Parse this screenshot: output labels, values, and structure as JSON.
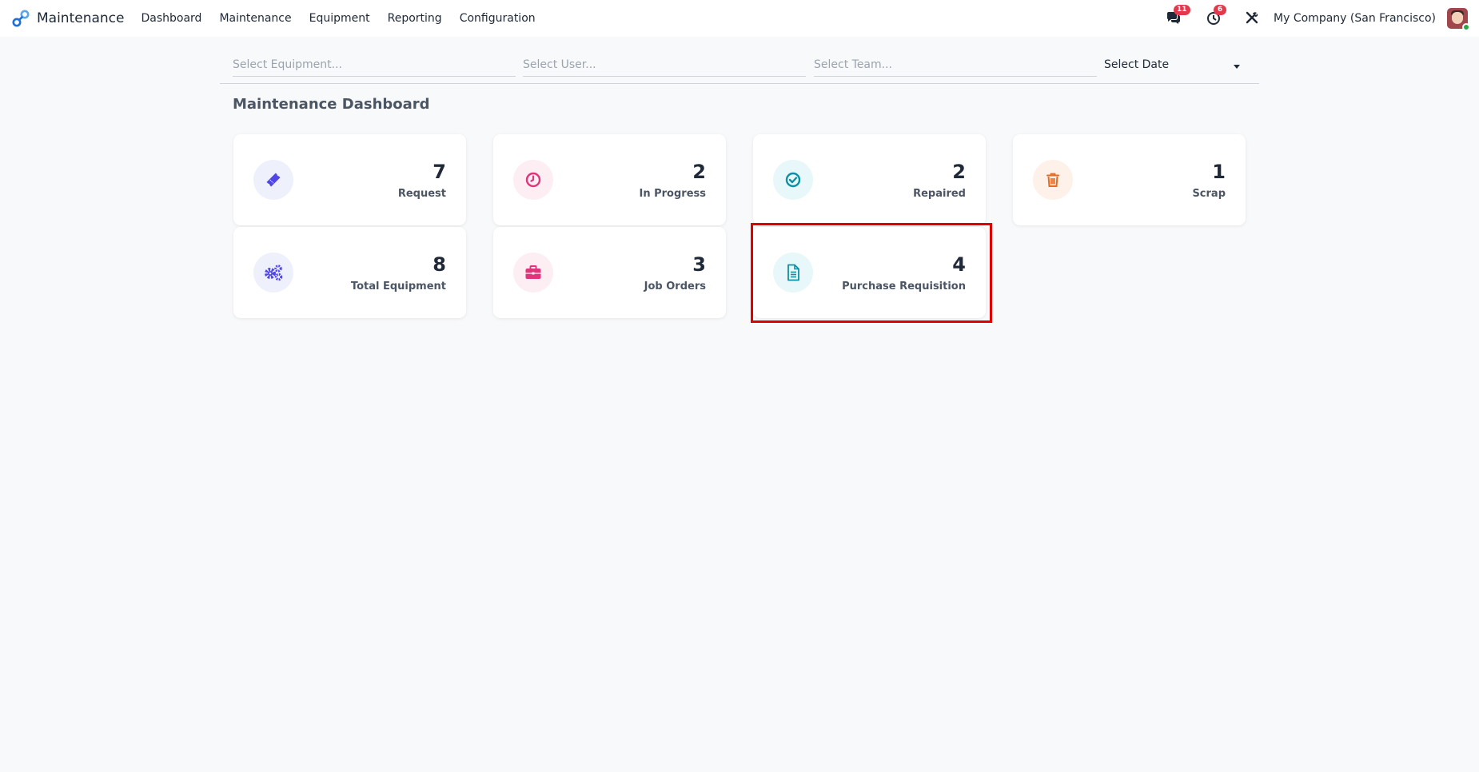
{
  "app": {
    "name": "Maintenance",
    "nav": [
      "Dashboard",
      "Maintenance",
      "Equipment",
      "Reporting",
      "Configuration"
    ],
    "messages_count": "11",
    "activities_count": "6",
    "company": "My Company (San Francisco)"
  },
  "filters": {
    "equipment_placeholder": "Select Equipment...",
    "user_placeholder": "Select User...",
    "team_placeholder": "Select Team...",
    "date_label": "Select Date"
  },
  "page": {
    "title": "Maintenance Dashboard"
  },
  "cards": [
    {
      "value": "7",
      "label": "Request",
      "icon": "ticket-icon",
      "color": "#4f46e5",
      "bg": "#eef0fc"
    },
    {
      "value": "2",
      "label": "In Progress",
      "icon": "clock-icon",
      "color": "#e0357a",
      "bg": "#fdeef4"
    },
    {
      "value": "2",
      "label": "Repaired",
      "icon": "check-circle-icon",
      "color": "#0e8fa3",
      "bg": "#e8f7f9"
    },
    {
      "value": "1",
      "label": "Scrap",
      "icon": "trash-icon",
      "color": "#ea6a1f",
      "bg": "#fdf1ea"
    },
    {
      "value": "8",
      "label": "Total Equipment",
      "icon": "gears-icon",
      "color": "#4f46e5",
      "bg": "#eef0fc"
    },
    {
      "value": "3",
      "label": "Job Orders",
      "icon": "briefcase-icon",
      "color": "#e0357a",
      "bg": "#fdeef4"
    },
    {
      "value": "4",
      "label": "Purchase Requisition",
      "icon": "document-icon",
      "color": "#0e8fa3",
      "bg": "#e8f7f9"
    }
  ],
  "highlight_color": "#e00000"
}
